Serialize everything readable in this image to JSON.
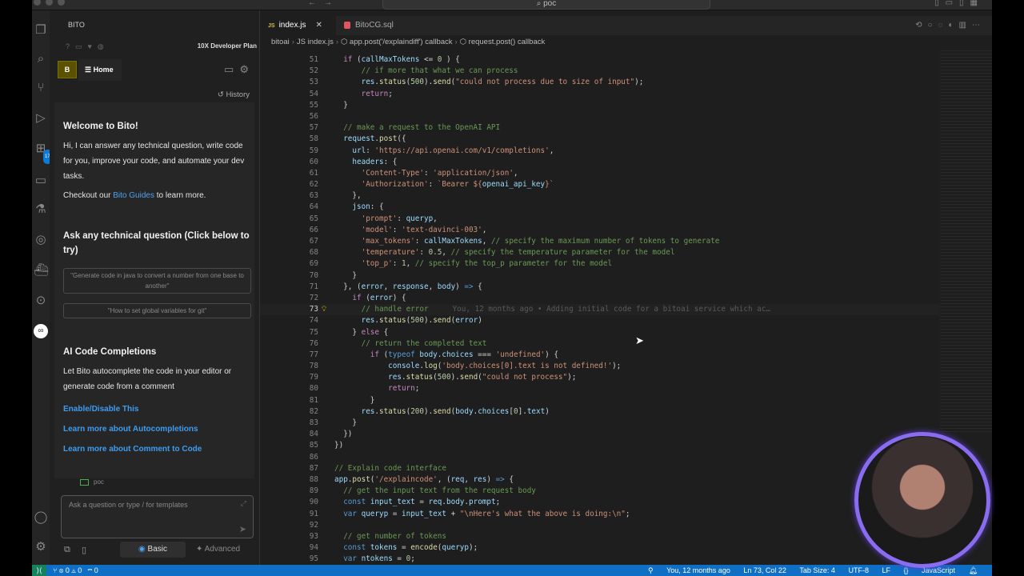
{
  "titlebar": {
    "search": "poc"
  },
  "sidebar": {
    "title": "BITO",
    "plan": "10X Developer Plan",
    "avatar_letter": "B",
    "home_label": "Home",
    "history_label": "History",
    "welcome_title": "Welcome to Bito!",
    "welcome_text": "Hi, I can answer any technical question, write code for you, improve your code, and automate your dev tasks.",
    "guides_pre": "Checkout our ",
    "guides_link": "Bito Guides",
    "guides_post": " to learn more.",
    "ask_title": "Ask any technical question (Click below to try)",
    "suggestions": [
      "\"Generate code in java to convert a number from one base to another\"",
      "\"How to set global variables for git\""
    ],
    "completions_title": "AI Code Completions",
    "completions_text": "Let Bito autocomplete the code in your editor or generate code from a comment",
    "links": [
      "Enable/Disable This",
      "Learn more about Autocompletions",
      "Learn more about Comment to Code"
    ],
    "workspace": "poc",
    "ask_placeholder": "Ask a question or type / for templates",
    "mode_basic": "Basic",
    "mode_advanced": "Advanced"
  },
  "editor": {
    "tabs": [
      {
        "label": "index.js",
        "icon": "JS"
      },
      {
        "label": "BitoCG.sql"
      }
    ],
    "breadcrumb": [
      "bitoai",
      "index.js",
      "app.post('/explaindiff') callback",
      "request.post() callback"
    ],
    "current_line": 73,
    "blame": "You, 12 months ago • Adding initial code for a bitoai service which ac…",
    "lines": [
      {
        "n": 51,
        "t": [
          [
            "p",
            "  "
          ],
          [
            "k",
            "if"
          ],
          [
            "p",
            " ("
          ],
          [
            "v",
            "callMaxTokens"
          ],
          [
            "p",
            " <= "
          ],
          [
            "n",
            "0"
          ],
          [
            "p",
            " ) {"
          ]
        ]
      },
      {
        "n": 52,
        "t": [
          [
            "p",
            "      "
          ],
          [
            "c",
            "// if more that what we can process"
          ]
        ]
      },
      {
        "n": 53,
        "t": [
          [
            "p",
            "      "
          ],
          [
            "v",
            "res"
          ],
          [
            "p",
            "."
          ],
          [
            "f",
            "status"
          ],
          [
            "p",
            "("
          ],
          [
            "n",
            "500"
          ],
          [
            "p",
            ")."
          ],
          [
            "f",
            "send"
          ],
          [
            "p",
            "("
          ],
          [
            "s",
            "\"could not process due to size of input\""
          ],
          [
            "p",
            ");"
          ]
        ]
      },
      {
        "n": 54,
        "t": [
          [
            "p",
            "      "
          ],
          [
            "k",
            "return"
          ],
          [
            "p",
            ";"
          ]
        ]
      },
      {
        "n": 55,
        "t": [
          [
            "p",
            "  }"
          ]
        ]
      },
      {
        "n": 56,
        "t": []
      },
      {
        "n": 57,
        "t": [
          [
            "p",
            "  "
          ],
          [
            "c",
            "// make a request to the OpenAI API"
          ]
        ]
      },
      {
        "n": 58,
        "t": [
          [
            "p",
            "  "
          ],
          [
            "v",
            "request"
          ],
          [
            "p",
            "."
          ],
          [
            "f",
            "post"
          ],
          [
            "p",
            "({"
          ]
        ]
      },
      {
        "n": 59,
        "t": [
          [
            "p",
            "    "
          ],
          [
            "v",
            "url"
          ],
          [
            "p",
            ": "
          ],
          [
            "s",
            "'https://api.openai.com/v1/completions'"
          ],
          [
            "p",
            ","
          ]
        ]
      },
      {
        "n": 60,
        "t": [
          [
            "p",
            "    "
          ],
          [
            "v",
            "headers"
          ],
          [
            "p",
            ": {"
          ]
        ]
      },
      {
        "n": 61,
        "t": [
          [
            "p",
            "      "
          ],
          [
            "s",
            "'Content-Type'"
          ],
          [
            "p",
            ": "
          ],
          [
            "s",
            "'application/json'"
          ],
          [
            "p",
            ","
          ]
        ]
      },
      {
        "n": 62,
        "t": [
          [
            "p",
            "      "
          ],
          [
            "s",
            "'Authorization'"
          ],
          [
            "p",
            ": "
          ],
          [
            "s",
            "`Bearer ${"
          ],
          [
            "v",
            "openai_api_key"
          ],
          [
            "s",
            "}`"
          ]
        ]
      },
      {
        "n": 63,
        "t": [
          [
            "p",
            "    },"
          ]
        ]
      },
      {
        "n": 64,
        "t": [
          [
            "p",
            "    "
          ],
          [
            "v",
            "json"
          ],
          [
            "p",
            ": {"
          ]
        ]
      },
      {
        "n": 65,
        "t": [
          [
            "p",
            "      "
          ],
          [
            "s",
            "'prompt'"
          ],
          [
            "p",
            ": "
          ],
          [
            "v",
            "queryp"
          ],
          [
            "p",
            ","
          ]
        ]
      },
      {
        "n": 66,
        "t": [
          [
            "p",
            "      "
          ],
          [
            "s",
            "'model'"
          ],
          [
            "p",
            ": "
          ],
          [
            "s",
            "'text-davinci-003'"
          ],
          [
            "p",
            ","
          ]
        ]
      },
      {
        "n": 67,
        "t": [
          [
            "p",
            "      "
          ],
          [
            "s",
            "'max_tokens'"
          ],
          [
            "p",
            ": "
          ],
          [
            "v",
            "callMaxTokens"
          ],
          [
            "p",
            ", "
          ],
          [
            "c",
            "// specify the maximum number of tokens to generate"
          ]
        ]
      },
      {
        "n": 68,
        "t": [
          [
            "p",
            "      "
          ],
          [
            "s",
            "'temperature'"
          ],
          [
            "p",
            ": "
          ],
          [
            "n",
            "0.5"
          ],
          [
            "p",
            ", "
          ],
          [
            "c",
            "// specify the temperature parameter for the model"
          ]
        ]
      },
      {
        "n": 69,
        "t": [
          [
            "p",
            "      "
          ],
          [
            "s",
            "'top_p'"
          ],
          [
            "p",
            ": "
          ],
          [
            "n",
            "1"
          ],
          [
            "p",
            ", "
          ],
          [
            "c",
            "// specify the top_p parameter for the model"
          ]
        ]
      },
      {
        "n": 70,
        "t": [
          [
            "p",
            "    }"
          ]
        ]
      },
      {
        "n": 71,
        "t": [
          [
            "p",
            "  }, ("
          ],
          [
            "v",
            "error"
          ],
          [
            "p",
            ", "
          ],
          [
            "v",
            "response"
          ],
          [
            "p",
            ", "
          ],
          [
            "v",
            "body"
          ],
          [
            "p",
            ") "
          ],
          [
            "d",
            "=>"
          ],
          [
            "p",
            " {"
          ]
        ]
      },
      {
        "n": 72,
        "t": [
          [
            "p",
            "    "
          ],
          [
            "k",
            "if"
          ],
          [
            "p",
            " ("
          ],
          [
            "v",
            "error"
          ],
          [
            "p",
            ") {"
          ]
        ]
      },
      {
        "n": 73,
        "t": [
          [
            "p",
            "      "
          ],
          [
            "c",
            "// handle error"
          ]
        ]
      },
      {
        "n": 74,
        "t": [
          [
            "p",
            "      "
          ],
          [
            "v",
            "res"
          ],
          [
            "p",
            "."
          ],
          [
            "f",
            "status"
          ],
          [
            "p",
            "("
          ],
          [
            "n",
            "500"
          ],
          [
            "p",
            ")."
          ],
          [
            "f",
            "send"
          ],
          [
            "p",
            "("
          ],
          [
            "v",
            "error"
          ],
          [
            "p",
            ")"
          ]
        ]
      },
      {
        "n": 75,
        "t": [
          [
            "p",
            "    } "
          ],
          [
            "k",
            "else"
          ],
          [
            "p",
            " {"
          ]
        ]
      },
      {
        "n": 76,
        "t": [
          [
            "p",
            "      "
          ],
          [
            "c",
            "// return the completed text"
          ]
        ]
      },
      {
        "n": 77,
        "t": [
          [
            "p",
            "        "
          ],
          [
            "k",
            "if"
          ],
          [
            "p",
            " ("
          ],
          [
            "d",
            "typeof"
          ],
          [
            "p",
            " "
          ],
          [
            "v",
            "body"
          ],
          [
            "p",
            "."
          ],
          [
            "v",
            "choices"
          ],
          [
            "p",
            " === "
          ],
          [
            "s",
            "'undefined'"
          ],
          [
            "p",
            ") {"
          ]
        ]
      },
      {
        "n": 78,
        "t": [
          [
            "p",
            "            "
          ],
          [
            "v",
            "console"
          ],
          [
            "p",
            "."
          ],
          [
            "f",
            "log"
          ],
          [
            "p",
            "("
          ],
          [
            "s",
            "'body.choices[0].text is not defined!'"
          ],
          [
            "p",
            ");"
          ]
        ]
      },
      {
        "n": 79,
        "t": [
          [
            "p",
            "            "
          ],
          [
            "v",
            "res"
          ],
          [
            "p",
            "."
          ],
          [
            "f",
            "status"
          ],
          [
            "p",
            "("
          ],
          [
            "n",
            "500"
          ],
          [
            "p",
            ")."
          ],
          [
            "f",
            "send"
          ],
          [
            "p",
            "("
          ],
          [
            "s",
            "\"could not process\""
          ],
          [
            "p",
            ");"
          ]
        ]
      },
      {
        "n": 80,
        "t": [
          [
            "p",
            "            "
          ],
          [
            "k",
            "return"
          ],
          [
            "p",
            ";"
          ]
        ]
      },
      {
        "n": 81,
        "t": [
          [
            "p",
            "        }"
          ]
        ]
      },
      {
        "n": 82,
        "t": [
          [
            "p",
            "      "
          ],
          [
            "v",
            "res"
          ],
          [
            "p",
            "."
          ],
          [
            "f",
            "status"
          ],
          [
            "p",
            "("
          ],
          [
            "n",
            "200"
          ],
          [
            "p",
            ")."
          ],
          [
            "f",
            "send"
          ],
          [
            "p",
            "("
          ],
          [
            "v",
            "body"
          ],
          [
            "p",
            "."
          ],
          [
            "v",
            "choices"
          ],
          [
            "p",
            "["
          ],
          [
            "n",
            "0"
          ],
          [
            "p",
            "]."
          ],
          [
            "v",
            "text"
          ],
          [
            "p",
            ")"
          ]
        ]
      },
      {
        "n": 83,
        "t": [
          [
            "p",
            "    }"
          ]
        ]
      },
      {
        "n": 84,
        "t": [
          [
            "p",
            "  })"
          ]
        ]
      },
      {
        "n": 85,
        "t": [
          [
            "p",
            "})"
          ]
        ]
      },
      {
        "n": 86,
        "t": []
      },
      {
        "n": 87,
        "t": [
          [
            "c",
            "// Explain code interface"
          ]
        ]
      },
      {
        "n": 88,
        "t": [
          [
            "v",
            "app"
          ],
          [
            "p",
            "."
          ],
          [
            "f",
            "post"
          ],
          [
            "p",
            "("
          ],
          [
            "s",
            "'/explaincode'"
          ],
          [
            "p",
            ", ("
          ],
          [
            "v",
            "req"
          ],
          [
            "p",
            ", "
          ],
          [
            "v",
            "res"
          ],
          [
            "p",
            ") "
          ],
          [
            "d",
            "=>"
          ],
          [
            "p",
            " {"
          ]
        ]
      },
      {
        "n": 89,
        "t": [
          [
            "p",
            "  "
          ],
          [
            "c",
            "// get the input text from the request body"
          ]
        ]
      },
      {
        "n": 90,
        "t": [
          [
            "p",
            "  "
          ],
          [
            "d",
            "const"
          ],
          [
            "p",
            " "
          ],
          [
            "v",
            "input_text"
          ],
          [
            "p",
            " = "
          ],
          [
            "v",
            "req"
          ],
          [
            "p",
            "."
          ],
          [
            "v",
            "body"
          ],
          [
            "p",
            "."
          ],
          [
            "v",
            "prompt"
          ],
          [
            "p",
            ";"
          ]
        ]
      },
      {
        "n": 91,
        "t": [
          [
            "p",
            "  "
          ],
          [
            "d",
            "var"
          ],
          [
            "p",
            " "
          ],
          [
            "v",
            "queryp"
          ],
          [
            "p",
            " = "
          ],
          [
            "v",
            "input_text"
          ],
          [
            "p",
            " + "
          ],
          [
            "s",
            "\"\\nHere's what the above is doing:\\n\""
          ],
          [
            "p",
            ";"
          ]
        ]
      },
      {
        "n": 92,
        "t": []
      },
      {
        "n": 93,
        "t": [
          [
            "p",
            "  "
          ],
          [
            "c",
            "// get number of tokens"
          ]
        ]
      },
      {
        "n": 94,
        "t": [
          [
            "p",
            "  "
          ],
          [
            "d",
            "const"
          ],
          [
            "p",
            " "
          ],
          [
            "v",
            "tokens"
          ],
          [
            "p",
            " = "
          ],
          [
            "f",
            "encode"
          ],
          [
            "p",
            "("
          ],
          [
            "v",
            "queryp"
          ],
          [
            "p",
            ");"
          ]
        ]
      },
      {
        "n": 95,
        "t": [
          [
            "p",
            "  "
          ],
          [
            "d",
            "var"
          ],
          [
            "p",
            " "
          ],
          [
            "v",
            "ntokens"
          ],
          [
            "p",
            " = "
          ],
          [
            "n",
            "0"
          ],
          [
            "p",
            ";"
          ]
        ]
      }
    ]
  },
  "status": {
    "errors": "0",
    "warnings": "0",
    "ports": "0",
    "blame": "You, 12 months ago",
    "position": "Ln 73, Col 22",
    "tab_size": "Tab Size: 4",
    "encoding": "UTF-8",
    "eol": "LF",
    "language": "JavaScript"
  },
  "colors": {
    "status_bar": "#0e6fc4",
    "remote": "#16825d",
    "link": "#4aa3f0",
    "webcam_ring": "#8a6cf0"
  }
}
